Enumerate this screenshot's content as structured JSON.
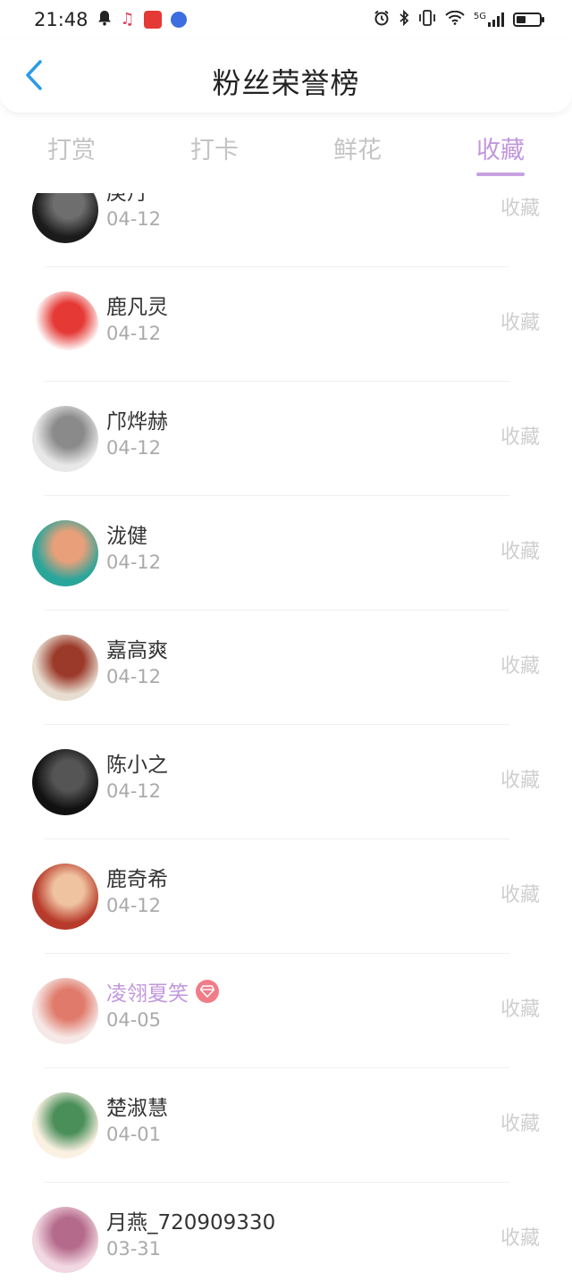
{
  "status_bar": {
    "time": "21:48",
    "network": "5G",
    "left_icons": [
      "bell-icon",
      "music-note-icon",
      "app-badge-icon",
      "music-app-icon"
    ],
    "right_icons": [
      "alarm-icon",
      "bluetooth-icon",
      "vibrate-icon",
      "wifi-icon",
      "signal-icon",
      "battery-icon"
    ]
  },
  "header": {
    "title": "粉丝荣誉榜",
    "back_icon": "chevron-left-icon",
    "accent_color": "#2b9be8"
  },
  "tabs": [
    {
      "label": "打赏",
      "active": false
    },
    {
      "label": "打卡",
      "active": false
    },
    {
      "label": "鲜花",
      "active": false
    },
    {
      "label": "收藏",
      "active": true
    }
  ],
  "active_color": "#c297dd",
  "fans": [
    {
      "name": "庚丹",
      "date": "04-12",
      "action": "收藏",
      "vip": false,
      "avatar_colors": [
        "#1b1b1b",
        "#6e6e6e"
      ]
    },
    {
      "name": "鹿凡灵",
      "date": "04-12",
      "action": "收藏",
      "vip": false,
      "avatar_colors": [
        "#ffffff",
        "#e53935"
      ]
    },
    {
      "name": "邝烨赫",
      "date": "04-12",
      "action": "收藏",
      "vip": false,
      "avatar_colors": [
        "#e8e8e8",
        "#8a8a8a"
      ]
    },
    {
      "name": "泷健",
      "date": "04-12",
      "action": "收藏",
      "vip": false,
      "avatar_colors": [
        "#2aa59a",
        "#e9a07a"
      ]
    },
    {
      "name": "嘉高爽",
      "date": "04-12",
      "action": "收藏",
      "vip": false,
      "avatar_colors": [
        "#e7ddd0",
        "#9b3a2a"
      ]
    },
    {
      "name": "陈小之",
      "date": "04-12",
      "action": "收藏",
      "vip": false,
      "avatar_colors": [
        "#111111",
        "#555555"
      ]
    },
    {
      "name": "鹿奇希",
      "date": "04-12",
      "action": "收藏",
      "vip": false,
      "avatar_colors": [
        "#b73a2b",
        "#f0c3a0"
      ]
    },
    {
      "name": "凌翎夏笑",
      "date": "04-05",
      "action": "收藏",
      "vip": true,
      "avatar_colors": [
        "#f6e8e6",
        "#e07a6a"
      ]
    },
    {
      "name": "楚淑慧",
      "date": "04-01",
      "action": "收藏",
      "vip": false,
      "avatar_colors": [
        "#fbf1e3",
        "#4a8f5a"
      ]
    },
    {
      "name": "月燕_720909330",
      "date": "03-31",
      "action": "收藏",
      "vip": false,
      "avatar_colors": [
        "#f2d8e2",
        "#b46a8a"
      ]
    }
  ]
}
